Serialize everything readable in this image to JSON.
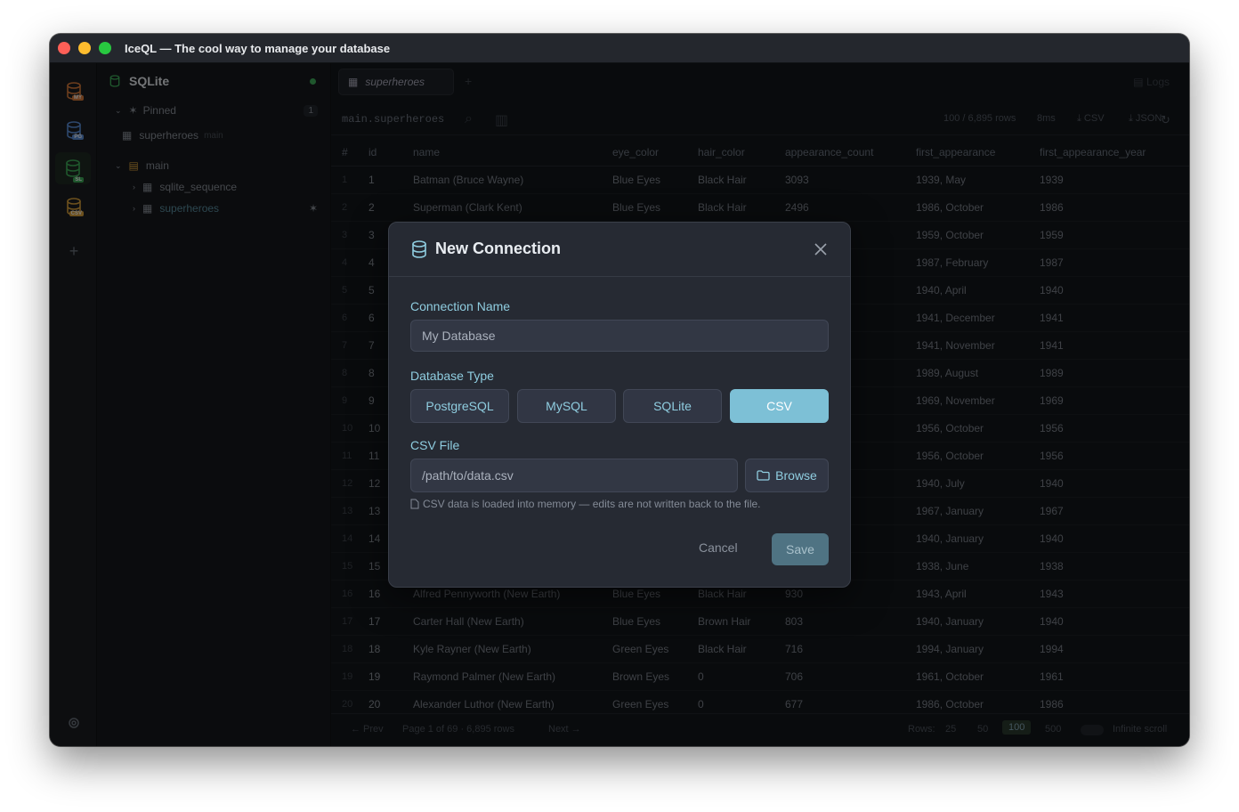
{
  "window": {
    "title": "IceQL — The cool way to manage your database"
  },
  "rail": {
    "items": [
      {
        "name": "mysql-connection",
        "badge": "MY",
        "color": "#d97b3b"
      },
      {
        "name": "postgres-connection",
        "badge": "PG",
        "color": "#5b8fd9"
      },
      {
        "name": "sqlite-connection",
        "badge": "SL",
        "color": "#3fae5a"
      },
      {
        "name": "csv-connection",
        "badge": "CSV",
        "color": "#d9a03b"
      }
    ],
    "add_label": "+"
  },
  "sidebar": {
    "connection_title": "SQLite",
    "pinned_label": "Pinned",
    "pinned_count": "1",
    "pinned_item": "superheroes",
    "pinned_item_schema": "main",
    "schema": "main",
    "tables": [
      "sqlite_sequence",
      "superheroes"
    ]
  },
  "main": {
    "tab_label": "superheroes",
    "add_tab": "+",
    "logs_label": "Logs",
    "query_name": "main.superheroes",
    "row_info": "100 / 6,895 rows",
    "time_info": "8ms",
    "export_csv": "CSV",
    "export_json": "JSON"
  },
  "table": {
    "columns": [
      "#",
      "id",
      "name",
      "eye_color",
      "hair_color",
      "appearance_count",
      "first_appearance",
      "first_appearance_year"
    ],
    "rows": [
      [
        "1",
        "1",
        "Batman (Bruce Wayne)",
        "Blue Eyes",
        "Black Hair",
        "3093",
        "1939, May",
        "1939"
      ],
      [
        "2",
        "2",
        "Superman (Clark Kent)",
        "Blue Eyes",
        "Black Hair",
        "2496",
        "1986, October",
        "1986"
      ],
      [
        "3",
        "3",
        "",
        "",
        "",
        "",
        "1959, October",
        "1959"
      ],
      [
        "4",
        "4",
        "",
        "",
        "",
        "",
        "1987, February",
        "1987"
      ],
      [
        "5",
        "5",
        "",
        "",
        "",
        "",
        "1940, April",
        "1940"
      ],
      [
        "6",
        "6",
        "",
        "",
        "",
        "",
        "1941, December",
        "1941"
      ],
      [
        "7",
        "7",
        "",
        "",
        "",
        "",
        "1941, November",
        "1941"
      ],
      [
        "8",
        "8",
        "",
        "",
        "",
        "",
        "1989, August",
        "1989"
      ],
      [
        "9",
        "9",
        "",
        "",
        "",
        "",
        "1969, November",
        "1969"
      ],
      [
        "10",
        "10",
        "",
        "",
        "",
        "",
        "1956, October",
        "1956"
      ],
      [
        "11",
        "11",
        "",
        "",
        "",
        "",
        "1956, October",
        "1956"
      ],
      [
        "12",
        "12",
        "",
        "",
        "",
        "",
        "1940, July",
        "1940"
      ],
      [
        "13",
        "13",
        "",
        "",
        "",
        "",
        "1967, January",
        "1967"
      ],
      [
        "14",
        "14",
        "",
        "",
        "",
        "",
        "1940, January",
        "1940"
      ],
      [
        "15",
        "15",
        "",
        "",
        "",
        "",
        "1938, June",
        "1938"
      ],
      [
        "16",
        "16",
        "Alfred Pennyworth (New Earth)",
        "Blue Eyes",
        "Black Hair",
        "930",
        "1943, April",
        "1943"
      ],
      [
        "17",
        "17",
        "Carter Hall (New Earth)",
        "Blue Eyes",
        "Brown Hair",
        "803",
        "1940, January",
        "1940"
      ],
      [
        "18",
        "18",
        "Kyle Rayner (New Earth)",
        "Green Eyes",
        "Black Hair",
        "716",
        "1994, January",
        "1994"
      ],
      [
        "19",
        "19",
        "Raymond Palmer (New Earth)",
        "Brown Eyes",
        "0",
        "706",
        "1961, October",
        "1961"
      ],
      [
        "20",
        "20",
        "Alexander Luthor (New Earth)",
        "Green Eyes",
        "0",
        "677",
        "1986, October",
        "1986"
      ]
    ]
  },
  "footer": {
    "prev": "← Prev",
    "page_info": "Page 1 of 69 · 6,895 rows",
    "next": "Next →",
    "rows_label": "Rows:",
    "sizes": [
      "25",
      "50",
      "100",
      "500"
    ],
    "active_size": "100",
    "infinite_label": "Infinite scroll"
  },
  "modal": {
    "title": "New Connection",
    "name_label": "Connection Name",
    "name_placeholder": "My Database",
    "type_label": "Database Type",
    "types": [
      "PostgreSQL",
      "MySQL",
      "SQLite",
      "CSV"
    ],
    "active_type": "CSV",
    "file_label": "CSV File",
    "file_placeholder": "/path/to/data.csv",
    "browse_label": "Browse",
    "note": "CSV data is loaded into memory — edits are not written back to the file.",
    "cancel_label": "Cancel",
    "save_label": "Save",
    "accent_color": "#7dc0d6"
  }
}
